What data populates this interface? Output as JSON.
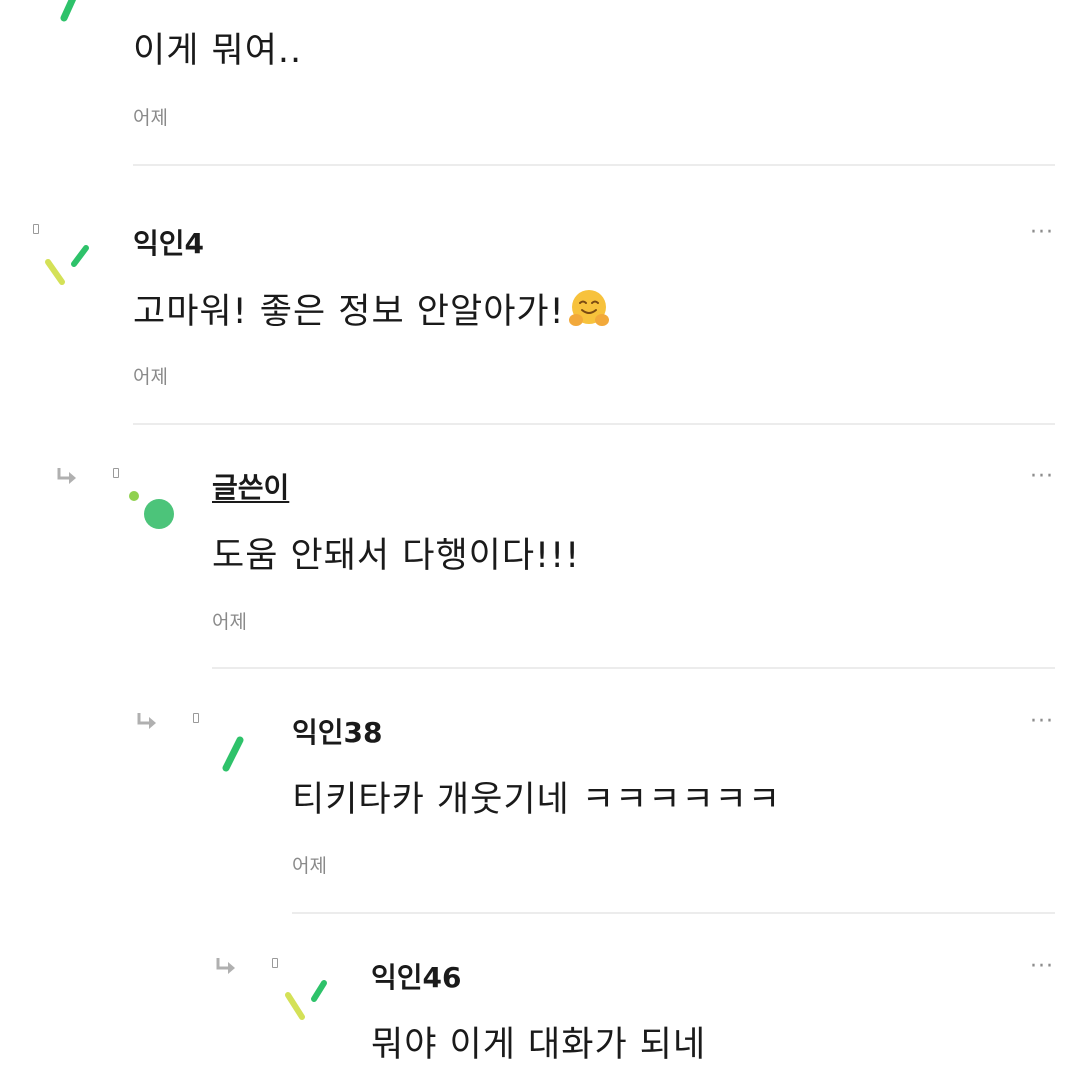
{
  "comments": [
    {
      "author": "",
      "text": "이게 뭐여..",
      "time": "어제"
    },
    {
      "author": "익인4",
      "text": "고마워! 좋은 정보 안알아가!",
      "emoji": "hugging-face-emoji",
      "time": "어제"
    },
    {
      "author": "글쓴이",
      "text": "도움 안돼서 다행이다!!!",
      "time": "어제"
    },
    {
      "author": "익인38",
      "text": "티키타카 개웃기네 ㅋㅋㅋㅋㅋㅋ",
      "time": "어제"
    },
    {
      "author": "익인46",
      "text": "뭐야 이게 대화가 되네",
      "time": ""
    }
  ],
  "more_label": "···",
  "icons": {
    "more": "more-options-icon",
    "reply": "reply-arrow-icon",
    "avatar": "avatar-icon"
  },
  "colors": {
    "green": "#2ec26a",
    "light_green": "#8fd14f",
    "yellow_green": "#d4e157",
    "avatar_circle": "#4cc47a"
  }
}
